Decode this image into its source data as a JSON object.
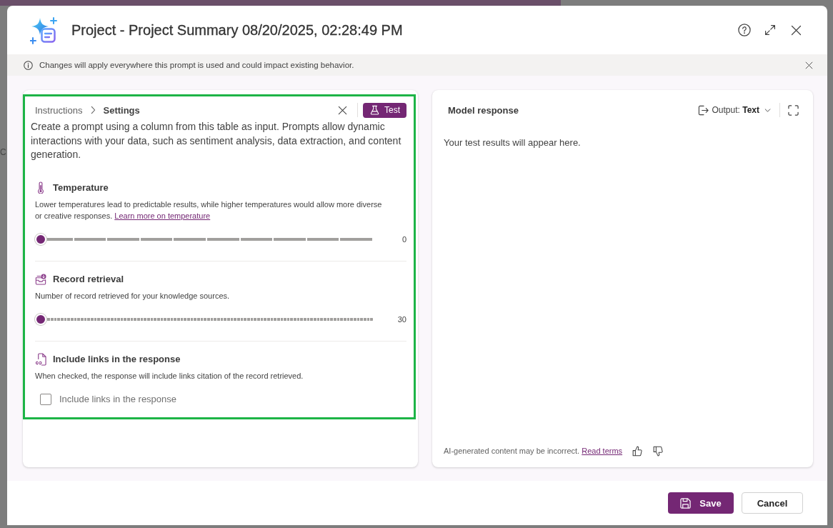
{
  "window": {
    "title": "Project - Project Summary 08/20/2025, 02:28:49 PM"
  },
  "backdrop": {
    "text": "C"
  },
  "info_bar": {
    "message": "Changes will apply everywhere this prompt is used and could impact existing behavior."
  },
  "settings_panel": {
    "highlighted": true,
    "breadcrumb": [
      {
        "label": "Instructions",
        "current": false
      },
      {
        "label": "Settings",
        "current": true
      }
    ],
    "test_button": "Test",
    "description": "Create a prompt using a column from this table as input. Prompts allow dynamic interactions with your data, such as sentiment analysis, data extraction, and content generation.",
    "temperature": {
      "title": "Temperature",
      "description": "Lower temperatures lead to predictable results, while higher temperatures would allow more diverse or creative responses.",
      "link": "Learn more on temperature",
      "level": 0,
      "value": "0"
    },
    "record_retrieval": {
      "title": "Record retrieval",
      "description": "Number of record retrieved for your knowledge sources.",
      "level": 0,
      "value": "30"
    },
    "include_links": {
      "title": "Include links in the response",
      "description": "When checked, the response will include links citation of the record retrieved.",
      "checkbox": {
        "label": "Include links in the response",
        "checked": false
      }
    }
  },
  "response_panel": {
    "title": "Model response",
    "output": {
      "label": "Output:",
      "value": "Text"
    },
    "empty_message": "Your test results will appear here.",
    "disclaimer": "AI-generated content may be incorrect.",
    "terms_link": "Read terms"
  },
  "footer": {
    "buttons": [
      {
        "label": "Save",
        "kind": "primary"
      },
      {
        "label": "Cancel",
        "kind": "secondary"
      }
    ]
  }
}
